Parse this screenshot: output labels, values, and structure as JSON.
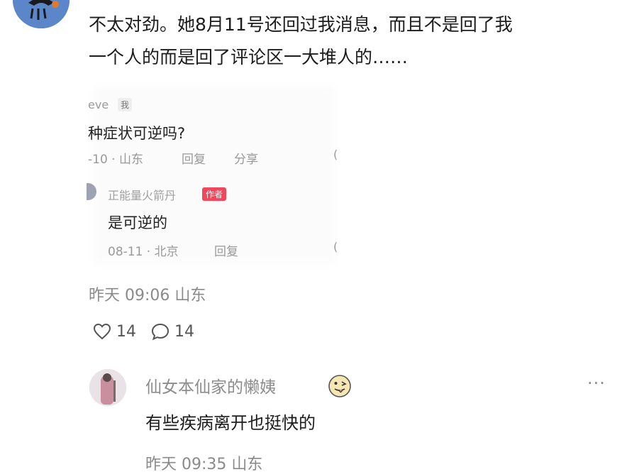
{
  "comment": {
    "line1": "不太对劲。她8月11号还回过我消息，而且不是回了我",
    "line2": "一个人的而是回了评论区一大堆人的……",
    "timestamp": "昨天 09:06 山东",
    "likes": "14",
    "replies": "14"
  },
  "embed": {
    "user_name": "eve",
    "me_tag": "我",
    "question": "种症状可逆吗?",
    "question_meta": "-10 · 山东",
    "reply_label": "回复",
    "share_label": "分享",
    "author_name": "正能量火箭丹",
    "author_badge": "作者",
    "answer": "是可逆的",
    "answer_meta": "08-11 · 北京",
    "reply_label_2": "回复"
  },
  "reply": {
    "user_name": "仙女本仙家的懒姨",
    "text": "有些疾病离开也挺快的",
    "timestamp": "昨天 09:35 山东",
    "more_label": "···"
  },
  "colors": {
    "badge": "#f0485a",
    "muted": "#8a8a8a",
    "text": "#1c1c1c"
  }
}
